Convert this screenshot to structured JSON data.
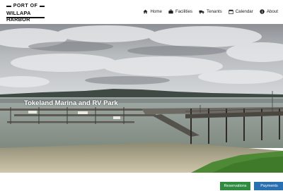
{
  "logo": {
    "line1": "PORT OF",
    "line2": "WILLAPA HARBOR"
  },
  "nav": {
    "items": [
      {
        "label": "Home",
        "icon": "home-icon"
      },
      {
        "label": "Facilities",
        "icon": "briefcase-icon"
      },
      {
        "label": "Tenants",
        "icon": "truck-icon"
      },
      {
        "label": "Calendar",
        "icon": "calendar-icon"
      },
      {
        "label": "About",
        "icon": "info-icon"
      }
    ]
  },
  "hero": {
    "title": "Tokeland Marina and RV Park"
  },
  "buttons": {
    "reservations": "Reservations",
    "payments": "Payments"
  },
  "colors": {
    "reservations_button": "#2e8b3f",
    "payments_button": "#2a6fb0"
  }
}
